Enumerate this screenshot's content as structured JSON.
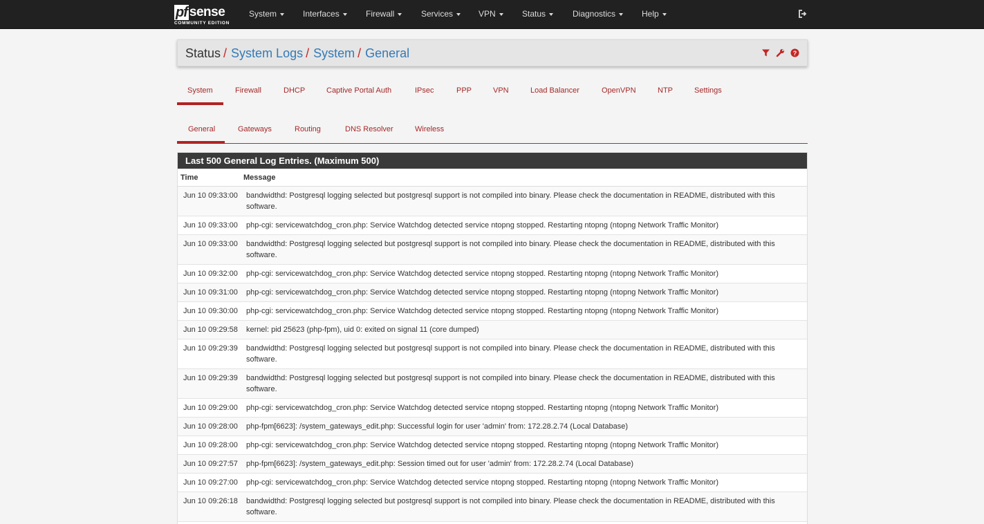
{
  "brand": {
    "pf": "pf",
    "sense": "sense",
    "edition": "COMMUNITY EDITION"
  },
  "nav": [
    "System",
    "Interfaces",
    "Firewall",
    "Services",
    "VPN",
    "Status",
    "Diagnostics",
    "Help"
  ],
  "icons": {
    "logout": "sign-out-icon",
    "filter": "filter-icon",
    "settings": "wrench-icon",
    "help": "question-circle-icon"
  },
  "colors": {
    "navbar": "#212121",
    "accent": "#c42525",
    "link": "#337ab7"
  },
  "breadcrumb": {
    "root": "Status",
    "level1": "System Logs",
    "level2": "System",
    "level3": "General",
    "separator": "/"
  },
  "tabs_primary": [
    "System",
    "Firewall",
    "DHCP",
    "Captive Portal Auth",
    "IPsec",
    "PPP",
    "VPN",
    "Load Balancer",
    "OpenVPN",
    "NTP",
    "Settings"
  ],
  "tabs_secondary": [
    "General",
    "Gateways",
    "Routing",
    "DNS Resolver",
    "Wireless"
  ],
  "log": {
    "heading": "Last 500 General Log Entries. (Maximum 500)",
    "col_time": "Time",
    "col_message": "Message",
    "rows": [
      {
        "time": "Jun 10 09:33:00",
        "message": "bandwidthd: Postgresql logging selected but postgresql support is not compiled into binary. Please check the documentation in README, distributed with this software."
      },
      {
        "time": "Jun 10 09:33:00",
        "message": "php-cgi: servicewatchdog_cron.php: Service Watchdog detected service ntopng stopped. Restarting ntopng (ntopng Network Traffic Monitor)"
      },
      {
        "time": "Jun 10 09:33:00",
        "message": "bandwidthd: Postgresql logging selected but postgresql support is not compiled into binary. Please check the documentation in README, distributed with this software."
      },
      {
        "time": "Jun 10 09:32:00",
        "message": "php-cgi: servicewatchdog_cron.php: Service Watchdog detected service ntopng stopped. Restarting ntopng (ntopng Network Traffic Monitor)"
      },
      {
        "time": "Jun 10 09:31:00",
        "message": "php-cgi: servicewatchdog_cron.php: Service Watchdog detected service ntopng stopped. Restarting ntopng (ntopng Network Traffic Monitor)"
      },
      {
        "time": "Jun 10 09:30:00",
        "message": "php-cgi: servicewatchdog_cron.php: Service Watchdog detected service ntopng stopped. Restarting ntopng (ntopng Network Traffic Monitor)"
      },
      {
        "time": "Jun 10 09:29:58",
        "message": "kernel: pid 25623 (php-fpm), uid 0: exited on signal 11 (core dumped)"
      },
      {
        "time": "Jun 10 09:29:39",
        "message": "bandwidthd: Postgresql logging selected but postgresql support is not compiled into binary. Please check the documentation in README, distributed with this software."
      },
      {
        "time": "Jun 10 09:29:39",
        "message": "bandwidthd: Postgresql logging selected but postgresql support is not compiled into binary. Please check the documentation in README, distributed with this software."
      },
      {
        "time": "Jun 10 09:29:00",
        "message": "php-cgi: servicewatchdog_cron.php: Service Watchdog detected service ntopng stopped. Restarting ntopng (ntopng Network Traffic Monitor)"
      },
      {
        "time": "Jun 10 09:28:00",
        "message": "php-fpm[6623]: /system_gateways_edit.php: Successful login for user 'admin' from: 172.28.2.74 (Local Database)"
      },
      {
        "time": "Jun 10 09:28:00",
        "message": "php-cgi: servicewatchdog_cron.php: Service Watchdog detected service ntopng stopped. Restarting ntopng (ntopng Network Traffic Monitor)"
      },
      {
        "time": "Jun 10 09:27:57",
        "message": "php-fpm[6623]: /system_gateways_edit.php: Session timed out for user 'admin' from: 172.28.2.74 (Local Database)"
      },
      {
        "time": "Jun 10 09:27:00",
        "message": "php-cgi: servicewatchdog_cron.php: Service Watchdog detected service ntopng stopped. Restarting ntopng (ntopng Network Traffic Monitor)"
      },
      {
        "time": "Jun 10 09:26:18",
        "message": "bandwidthd: Postgresql logging selected but postgresql support is not compiled into binary. Please check the documentation in README, distributed with this software."
      }
    ]
  }
}
